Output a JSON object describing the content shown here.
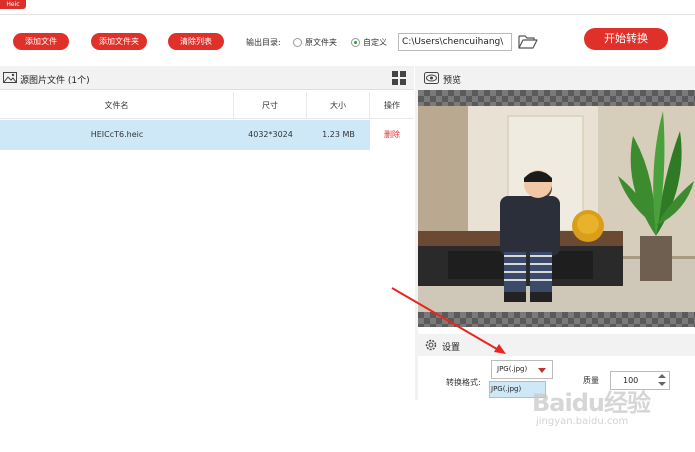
{
  "app": {
    "badge": "Heic"
  },
  "toolbar": {
    "add_file": "添加文件",
    "add_folder": "添加文件夹",
    "clear_list": "清除列表",
    "output_label": "输出目录:",
    "radio_original": "原文件夹",
    "radio_custom": "自定义",
    "output_path": "C:\\Users\\chencuihang\\",
    "start": "开始转换"
  },
  "file_panel": {
    "title": "源图片文件 (1个)",
    "columns": {
      "name": "文件名",
      "size": "尺寸",
      "bytes": "大小",
      "op": "操作"
    },
    "rows": [
      {
        "name": "HEICcT6.heic",
        "size": "4032*3024",
        "bytes": "1.23 MB",
        "op": "删除"
      }
    ]
  },
  "preview": {
    "title": "预览"
  },
  "settings": {
    "title": "设置",
    "format_label": "转换格式:",
    "format_value": "JPG(.jpg)",
    "format_options": [
      "JPG(.jpg)"
    ],
    "quality_label": "质量",
    "quality_value": "100"
  },
  "watermark": {
    "logo": "Baidu经验",
    "sub": "jingyan.baidu.com"
  },
  "colors": {
    "accent": "#e0302a",
    "selected_row": "#cfe8f8",
    "radio_on": "#2a9d3a"
  }
}
